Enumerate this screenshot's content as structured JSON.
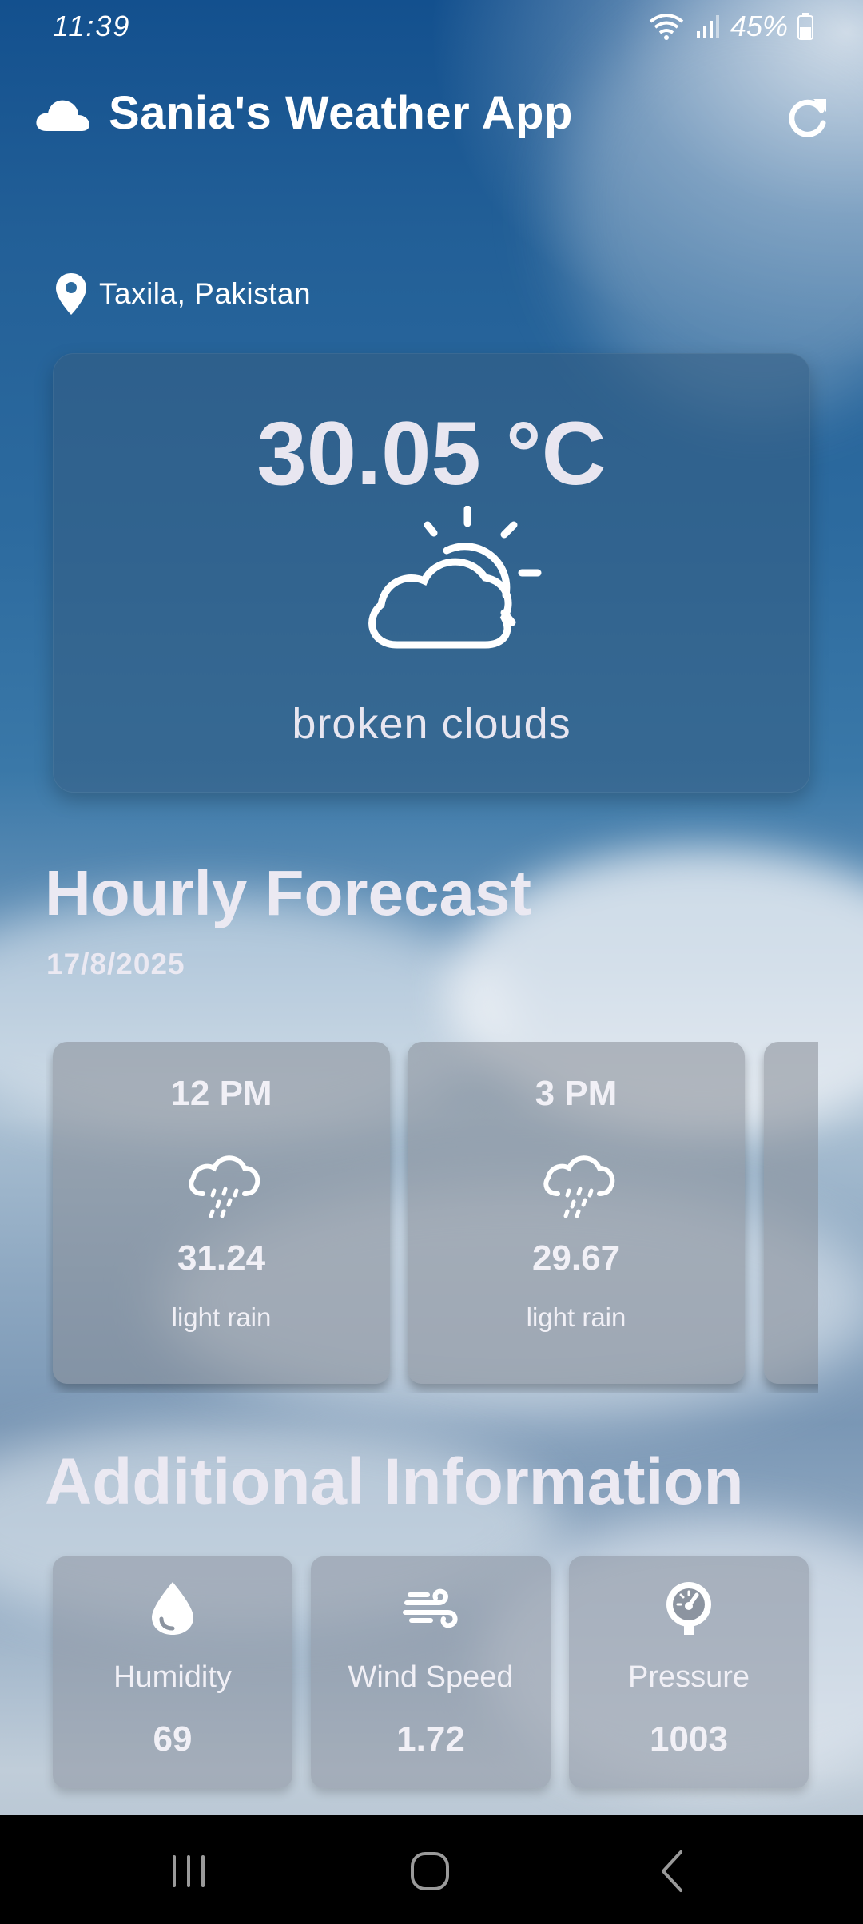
{
  "status_bar": {
    "time": "11:39",
    "battery": "45%"
  },
  "app_bar": {
    "title": "Sania's Weather App",
    "icon": "cloud-icon",
    "action_icon": "refresh-icon"
  },
  "location": {
    "icon": "location-pin-icon",
    "text": "Taxila, Pakistan"
  },
  "current": {
    "temperature": "30.05 °C",
    "icon": "partly-cloudy-sun-icon",
    "description": "broken clouds"
  },
  "hourly": {
    "heading": "Hourly Forecast",
    "date": "17/8/2025",
    "items": [
      {
        "time": "12 PM",
        "icon": "rain-cloud-icon",
        "temp": "31.24",
        "desc": "light rain"
      },
      {
        "time": "3 PM",
        "icon": "rain-cloud-icon",
        "temp": "29.67",
        "desc": "light rain"
      }
    ]
  },
  "additional": {
    "heading": "Additional Information",
    "items": [
      {
        "label": "Humidity",
        "icon": "water-drop-icon",
        "value": "69"
      },
      {
        "label": "Wind Speed",
        "icon": "wind-icon",
        "value": "1.72"
      },
      {
        "label": "Pressure",
        "icon": "gauge-icon",
        "value": "1003"
      }
    ]
  },
  "nav_bar": {
    "buttons": [
      "recent-apps-icon",
      "home-icon",
      "back-icon"
    ]
  },
  "colors": {
    "text_primary": "#ebe9f2",
    "sky_top": "#13508e",
    "nav_background": "#000000"
  }
}
